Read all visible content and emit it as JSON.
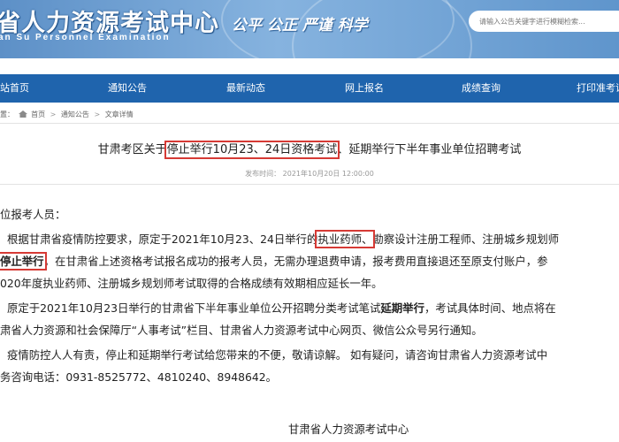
{
  "header": {
    "logo_cn": "省人力资源考试中心",
    "logo_en": "an Su Personnel Examination",
    "slogan": "公平 公正 严谨 科学",
    "search_placeholder": "请输入公告关键字进行模糊检索..."
  },
  "nav": {
    "items": [
      "站首页",
      "通知公告",
      "最新动态",
      "网上报名",
      "成绩查询",
      "打印准考证"
    ]
  },
  "breadcrumb": {
    "prefix": "置：",
    "items": [
      "首页",
      "通知公告",
      "文章详情"
    ],
    "separator": ">"
  },
  "article": {
    "title_pre": "甘肃考区关于",
    "title_highlight": "停止举行10月23、24日资格考试",
    "title_post": "、延期举行下半年事业单位招聘考试",
    "meta": "发布时间：  2021年10月20日 12:00:00",
    "salutation": "位报考人员：",
    "p1_l1_a": "根据甘肃省疫情防控要求，原定于2021年10月23、24日举行的",
    "p1_l1_box": "执业药师、",
    "p1_l1_b": "勘察设计注册工程师、注册城乡规划师",
    "p1_l2_box": "停止举行",
    "p1_l2_b": "，在甘肃省上述资格考试报名成功的报考人员，无需办理退费申请，报考费用直接退还至原支付账户，参",
    "p1_l3": "020年度执业药师、注册城乡规划师考试取得的合格成绩有效期相应延长一年。",
    "p2_l1_a": "原定于2021年10月23日举行的甘肃省下半年事业单位公开招聘分类考试笔试",
    "p2_l1_bold": "延期举行",
    "p2_l1_b": "，考试具体时间、地点将在",
    "p2_l2": "肃省人力资源和社会保障厅“人事考试”栏目、甘肃省人力资源考试中心网页、微信公众号另行通知。",
    "p3_l1": "疫情防控人人有责，停止和延期举行考试给您带来的不便，敬请谅解。  如有疑问，请咨询甘肃省人力资源考试中",
    "p3_l2": "务咨询电话：0931-8525772、4810240、8948642。",
    "signature": "甘肃省人力资源考试中心"
  },
  "colors": {
    "nav_bg": "#1f64ad",
    "banner": "#6a9fd4",
    "highlight_box": "#d63a35"
  }
}
